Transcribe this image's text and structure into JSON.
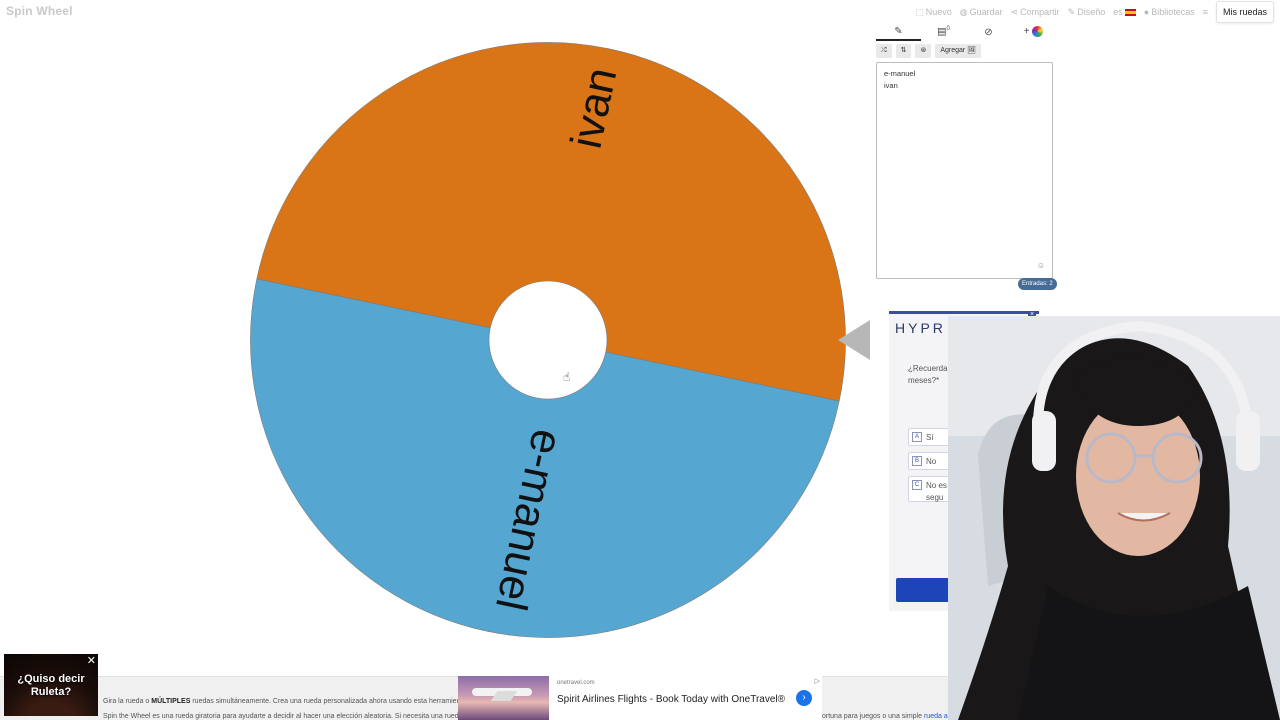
{
  "app": {
    "logo": "Spin Wheel"
  },
  "topnav": {
    "items": [
      {
        "icon": "new-icon",
        "label": "Nuevo"
      },
      {
        "icon": "save-icon",
        "label": "Guardar"
      },
      {
        "icon": "share-icon",
        "label": "Compartir"
      },
      {
        "icon": "design-icon",
        "label": "Diseño"
      },
      {
        "icon": "language-icon",
        "label": "es"
      },
      {
        "icon": "globe-icon",
        "label": "Bibliotecas"
      }
    ],
    "my_wheels": "Mis ruedas"
  },
  "wheel": {
    "segments": [
      {
        "label": "ivan",
        "color": "#d97417"
      },
      {
        "label": "e-manuel",
        "color": "#55a7d1"
      }
    ]
  },
  "editor": {
    "tabs": {
      "edit_icon": "pencil-icon",
      "results_icon": "clipboard-icon",
      "results_badge": "0",
      "hide_icon": "eye-off-icon",
      "add_color": "+"
    },
    "toolbar": {
      "shuffle": "⤮",
      "sort": "⇅",
      "image": "⊛",
      "add_label": "Agregar 🖼"
    },
    "entries": [
      "e-manuel",
      "ivan"
    ],
    "entries_count": "Entradas: 2"
  },
  "survey_ad": {
    "brand": "HYPR",
    "question": "¿Recuerda algún anu Electrolux meses?*",
    "options": [
      {
        "key": "A",
        "label": "Sí"
      },
      {
        "key": "B",
        "label": "No"
      },
      {
        "key": "C",
        "label": "No es segu"
      }
    ]
  },
  "bottom": {
    "desc_line1_pre": "Gira la rueda o ",
    "desc_line1_bold": "MÚLTIPLES",
    "desc_line1_post": " ruedas simultáneamente. Crea una rueda personalizada ahora usando esta herramienta",
    "desc_line2": "Spin the Wheel es una rueda giratoria para ayudarte a decidir al hacer una elección aleatoria. Si necesita una rueda",
    "desc_right": "ortuna para juegos o una simple",
    "desc_right_link": "rueda al s",
    "roulette_ad": "¿Quiso decir Ruleta?",
    "flight_ad": {
      "domain": "onetravel.com",
      "title": "Spirit Airlines Flights - Book Today with OneTravel®",
      "go": "›",
      "mark": "▷"
    }
  },
  "colors": {
    "wheel_orange": "#d97417",
    "wheel_blue": "#55a7d1",
    "pointer": "#b7b7b7",
    "accent": "#456c97"
  }
}
